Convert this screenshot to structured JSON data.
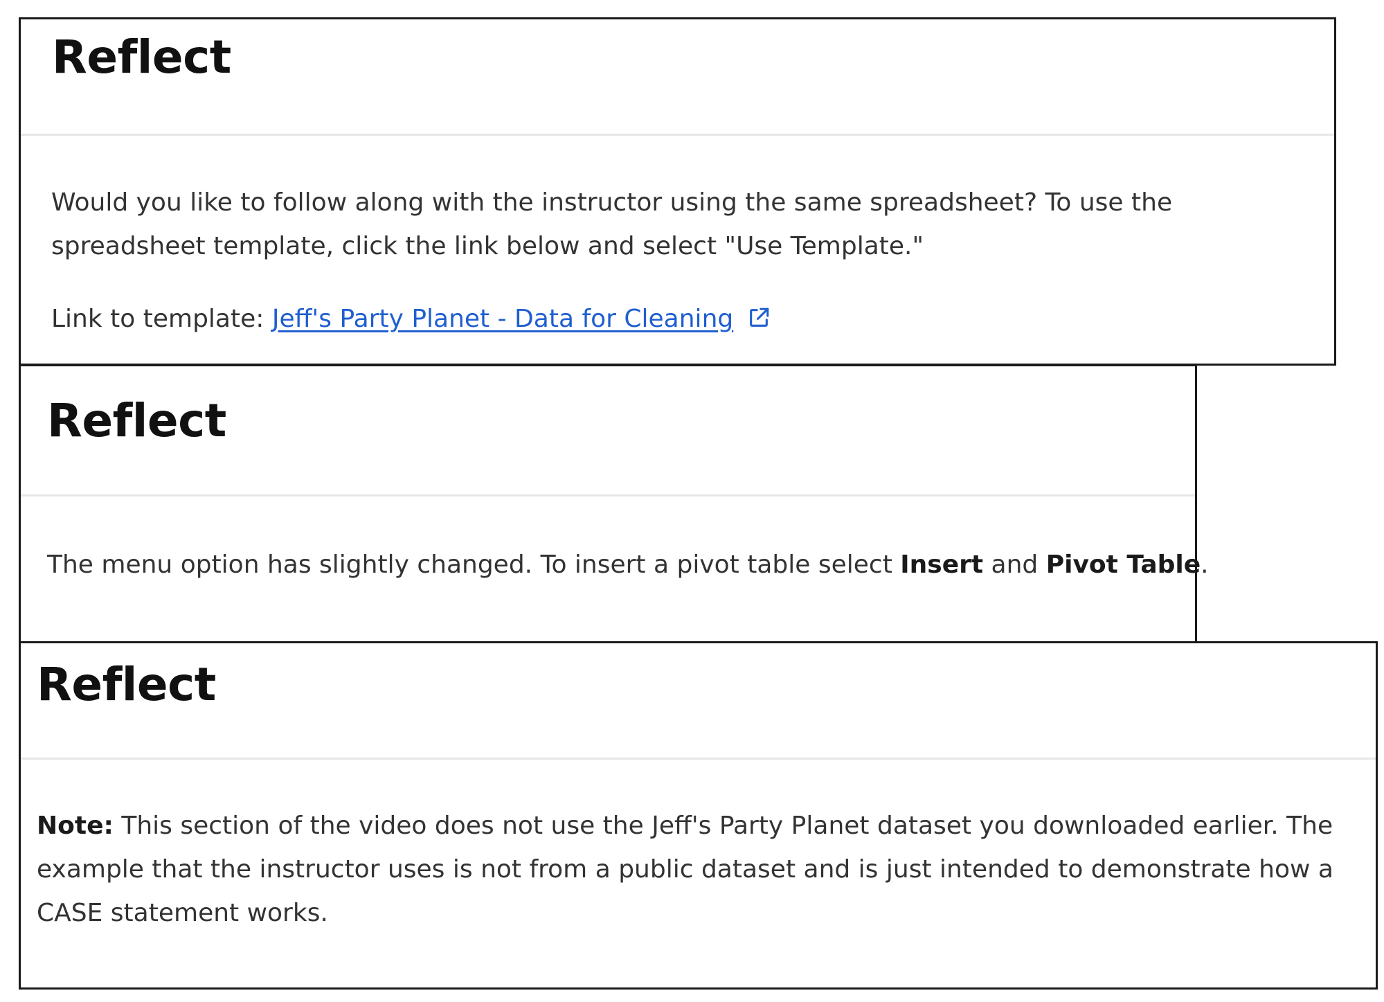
{
  "cards": [
    {
      "title": "Reflect",
      "paragraph": "Would you like to follow along with the instructor using the same spreadsheet? To use the spreadsheet template, click the link below and select \"Use Template.\"",
      "link_prefix": "Link to template: ",
      "link_text": "Jeff's Party Planet - Data for Cleaning",
      "link_icon": "external-link-icon"
    },
    {
      "title": "Reflect",
      "text_before": "The menu option has slightly changed. To insert a pivot table select ",
      "bold_1": "Insert",
      "text_middle": " and ",
      "bold_2": "Pivot Table",
      "text_after": "."
    },
    {
      "title": "Reflect",
      "note_label": "Note:",
      "note_text": " This section of the video does not use the Jeff's Party Planet dataset you downloaded earlier. The example that the instructor uses is not from a public dataset and is just intended to demonstrate how a CASE statement works."
    }
  ],
  "colors": {
    "link": "#1f5fd0",
    "body_text": "#333333",
    "title_text": "#111111",
    "card_border": "#1a1a1a",
    "divider": "#e6e6e6"
  }
}
